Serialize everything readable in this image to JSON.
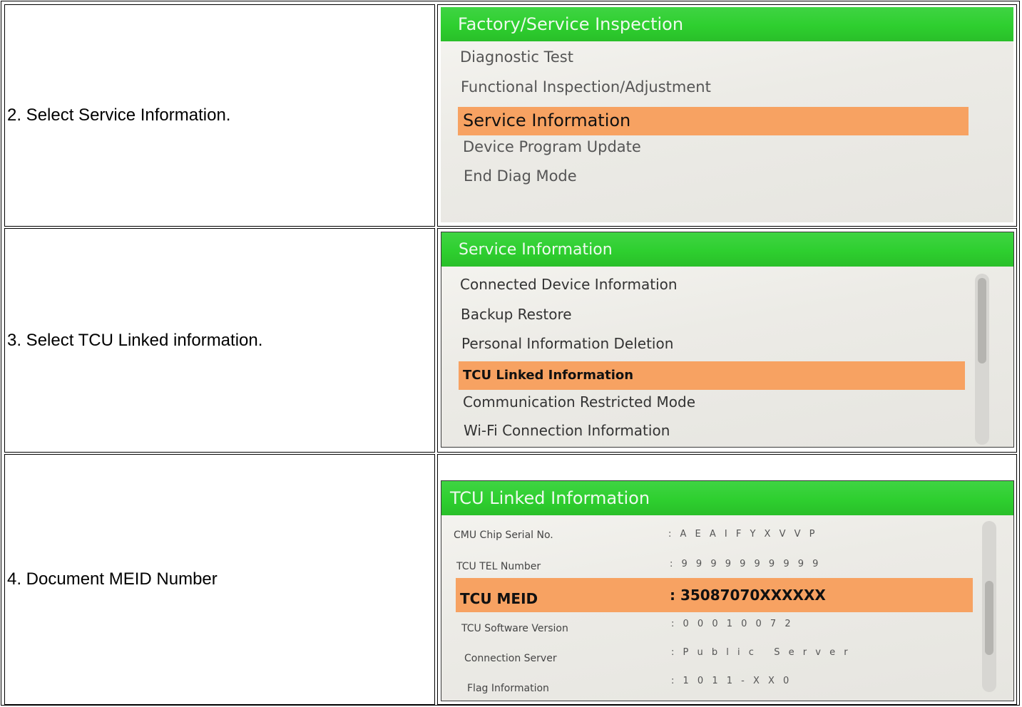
{
  "rows": [
    {
      "step": "2. Select Service Information.",
      "screen": {
        "title": "Factory/Service Inspection",
        "items": [
          "Diagnostic Test",
          "Functional Inspection/Adjustment",
          "Service Information",
          "Device Program Update",
          "End Diag Mode"
        ],
        "selected": "Service Information"
      }
    },
    {
      "step": "3. Select TCU Linked information.",
      "screen": {
        "title": "Service Information",
        "items": [
          "Connected Device Information",
          "Backup Restore",
          "Personal Information Deletion",
          "TCU Linked Information",
          "Communication Restricted Mode",
          "Wi-Fi Connection Information"
        ],
        "selected": "TCU Linked Information"
      }
    },
    {
      "step": "4. Document MEID Number",
      "screen": {
        "title": "TCU Linked Information",
        "fields": [
          {
            "label": "CMU Chip Serial No.",
            "value": ": A E A I F Y X V V P"
          },
          {
            "label": "TCU TEL Number",
            "value": ": 9 9 9 9 9 9 9 9 9 9"
          },
          {
            "label": "TCU MEID",
            "value": ": 35087070XXXXXX"
          },
          {
            "label": "TCU Software Version",
            "value": ": 0 0 0 1 0 0 7 2"
          },
          {
            "label": "Connection Server",
            "value": ": P u b l i c   S e r v e r"
          },
          {
            "label": "Flag Information",
            "value": ": 1 0 1 1 - X X 0"
          }
        ],
        "selected": "TCU MEID"
      }
    }
  ],
  "colors": {
    "header_green": "#2ecf2f",
    "highlight_orange": "#f7a262",
    "screen_bg": "#ecebe6"
  }
}
